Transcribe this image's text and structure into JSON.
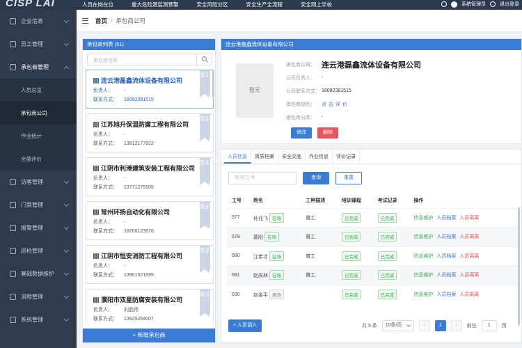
{
  "topbar": {
    "logo": "CISP LAI",
    "nav": [
      "人员在岗在位",
      "重大危险源监测预警",
      "安全风险分区",
      "安全生产全流程",
      "安全网上学校"
    ],
    "user": "系统管理员",
    "logout": "退出登录"
  },
  "sidebar": {
    "items": [
      {
        "label": "企业信息"
      },
      {
        "label": "员工管理"
      },
      {
        "label": "承包商管理"
      },
      {
        "label": "访客管理"
      },
      {
        "label": "门禁管理"
      },
      {
        "label": "报警管理"
      },
      {
        "label": "巡检管理"
      },
      {
        "label": "基础数据维护"
      },
      {
        "label": "流程管理"
      },
      {
        "label": "系统管理"
      }
    ],
    "sub": [
      "人员总览",
      "承包商公司",
      "作业统计",
      "全德评价"
    ]
  },
  "breadcrumb": {
    "home": "首页",
    "sep": "/",
    "current": "承包商公司"
  },
  "left": {
    "header": "承包商列表 (51)",
    "search_placeholder": "承包商名称",
    "add_label": "+ 新增承包商",
    "cards": [
      {
        "name": "连云港磊鑫流体设备有限公司",
        "person_k": "负责人：",
        "person": "-",
        "phone_k": "联系方式：",
        "phone": "18082391515",
        "ribbon": "暂无"
      },
      {
        "name": "江苏旭升保温防腐工程有限公司",
        "person_k": "负责人：",
        "person": "-",
        "phone_k": "联系方式：",
        "phone": "13812177822",
        "ribbon": "暂无"
      },
      {
        "name": "江阴市利港建筑安装工程有限公司",
        "person_k": "负责人：",
        "person": "-",
        "phone_k": "联系方式：",
        "phone": "13771275505",
        "ribbon": "暂无"
      },
      {
        "name": "常州环扬自动化有限公司",
        "person_k": "负责人：",
        "person": "-",
        "phone_k": "联系方式：",
        "phone": "18706123976",
        "ribbon": "暂无"
      },
      {
        "name": "江阴市恒安消防工程有限公司",
        "person_k": "负责人：",
        "person": "-",
        "phone_k": "联系方式：",
        "phone": "13901521699",
        "ribbon": "暂无"
      },
      {
        "name": "濮阳市双星防腐安装有限公司",
        "person_k": "负责人：",
        "person": "刘品伟",
        "phone_k": "联系方式：",
        "phone": "13925254007",
        "ribbon": "暂无"
      }
    ]
  },
  "detail": {
    "header": "连云港磊鑫流体设备有限公司",
    "photo": "暂无",
    "rows": [
      {
        "k": "承包商公司：",
        "v": "连云港磊鑫流体设备有限公司"
      },
      {
        "k": "公司负责人：",
        "v": "-"
      },
      {
        "k": "公司联系方式：",
        "v": "18082391515"
      },
      {
        "k": "承包商级别：",
        "v": "点击评价"
      },
      {
        "k": "承包商分类：",
        "v": "-"
      }
    ],
    "edit": "修改",
    "delete": "删除"
  },
  "tabs": [
    "人员信息",
    "资质档案",
    "安全交底",
    "作业信息",
    "评价记录"
  ],
  "filter": {
    "placeholder": "姓名/工号",
    "query": "查询",
    "reset": "重置"
  },
  "table": {
    "headers": [
      "工号",
      "姓名",
      "工种描述",
      "培训课程",
      "考试记录",
      "操作"
    ],
    "rows": [
      {
        "id": "577",
        "name": "孙兆飞",
        "status": "在场",
        "job": "普工",
        "train": "已完成",
        "exam": "已完成"
      },
      {
        "id": "579",
        "name": "葛阳",
        "status": "在场",
        "job": "普工",
        "train": "已完成",
        "exam": "已完成"
      },
      {
        "id": "580",
        "name": "江希才",
        "status": "在场",
        "job": "普工",
        "train": "已完成",
        "exam": "已完成"
      },
      {
        "id": "581",
        "name": "赵庆林",
        "status": "在场",
        "job": "普工",
        "train": "已完成",
        "exam": "已完成"
      },
      {
        "id": "030",
        "name": "赵金平",
        "status": "离场",
        "job": "",
        "train": "已完成",
        "exam": "已完成"
      }
    ],
    "ops": [
      "信息维护",
      "人员档案",
      "人员离离"
    ]
  },
  "footer": {
    "add": "+ 人员调入",
    "total": "共 5 条",
    "pagesize": "10条/页",
    "page": "1",
    "goto_k": "前往",
    "goto_v": "1",
    "page_unit": "页"
  }
}
